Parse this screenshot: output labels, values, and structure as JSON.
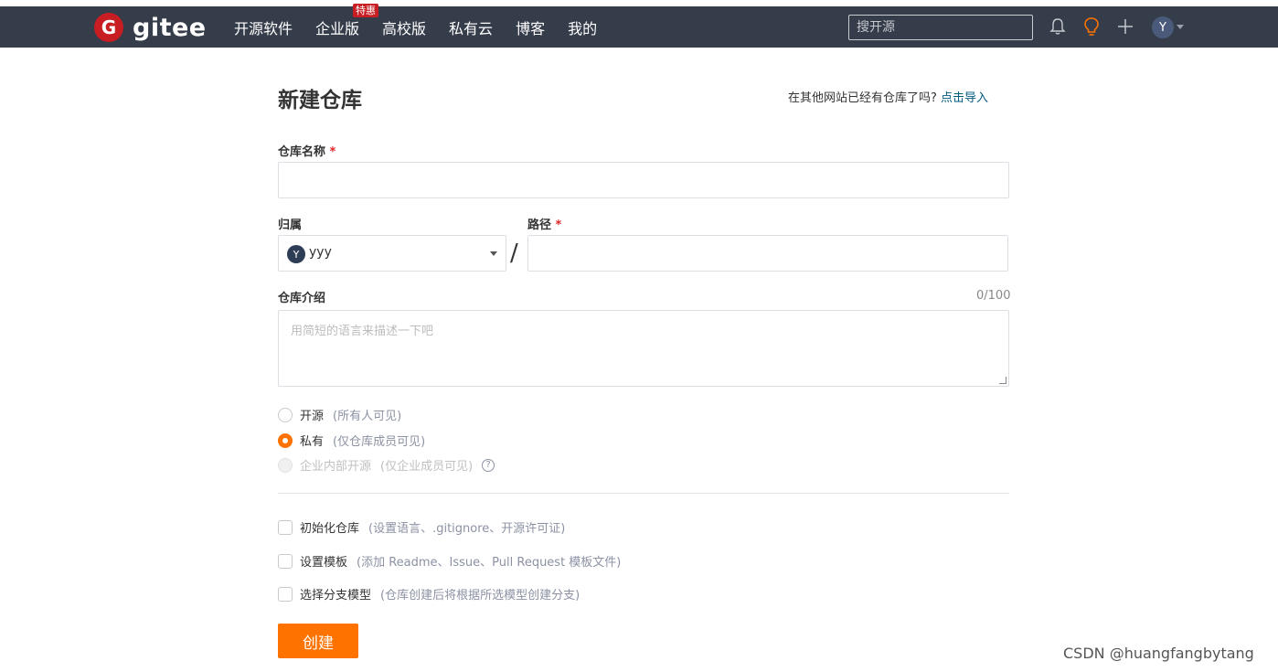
{
  "header": {
    "logo_glyph": "G",
    "logo_text": "gitee",
    "nav": [
      "开源软件",
      "企业版",
      "高校版",
      "私有云",
      "博客",
      "我的"
    ],
    "badge": "特惠",
    "search_placeholder": "搜开源",
    "avatar_letter": "Y",
    "icons": [
      "bell-icon",
      "bulb-icon",
      "plus-icon"
    ]
  },
  "page": {
    "title": "新建仓库",
    "import_prompt": "在其他网站已经有仓库了吗?",
    "import_link": "点击导入",
    "repo_name_label": "仓库名称",
    "required_mark": "*",
    "owner_label": "归属",
    "owner_avatar": "Y",
    "owner_name": "yyy",
    "slash": "/",
    "path_label": "路径",
    "intro_label": "仓库介绍",
    "intro_counter": "0/100",
    "intro_placeholder": "用简短的语言来描述一下吧",
    "visibility": [
      {
        "label": "开源",
        "hint": "(所有人可见)",
        "state": "unchecked"
      },
      {
        "label": "私有",
        "hint": "(仅仓库成员可见)",
        "state": "checked"
      },
      {
        "label": "企业内部开源",
        "hint": "(仅企业成员可见)",
        "state": "disabled"
      }
    ],
    "options": [
      {
        "label": "初始化仓库",
        "hint": "(设置语言、.gitignore、开源许可证)"
      },
      {
        "label": "设置模板",
        "hint": "(添加 Readme、Issue、Pull Request 模板文件)"
      },
      {
        "label": "选择分支模型",
        "hint": "(仓库创建后将根据所选模型创建分支)"
      }
    ],
    "create_button": "创建",
    "watermark": "CSDN @huangfangbytang"
  },
  "colors": {
    "header_bg": "#353c4a",
    "accent": "#fe7300",
    "brand_red": "#c71d23",
    "link": "#005980"
  }
}
